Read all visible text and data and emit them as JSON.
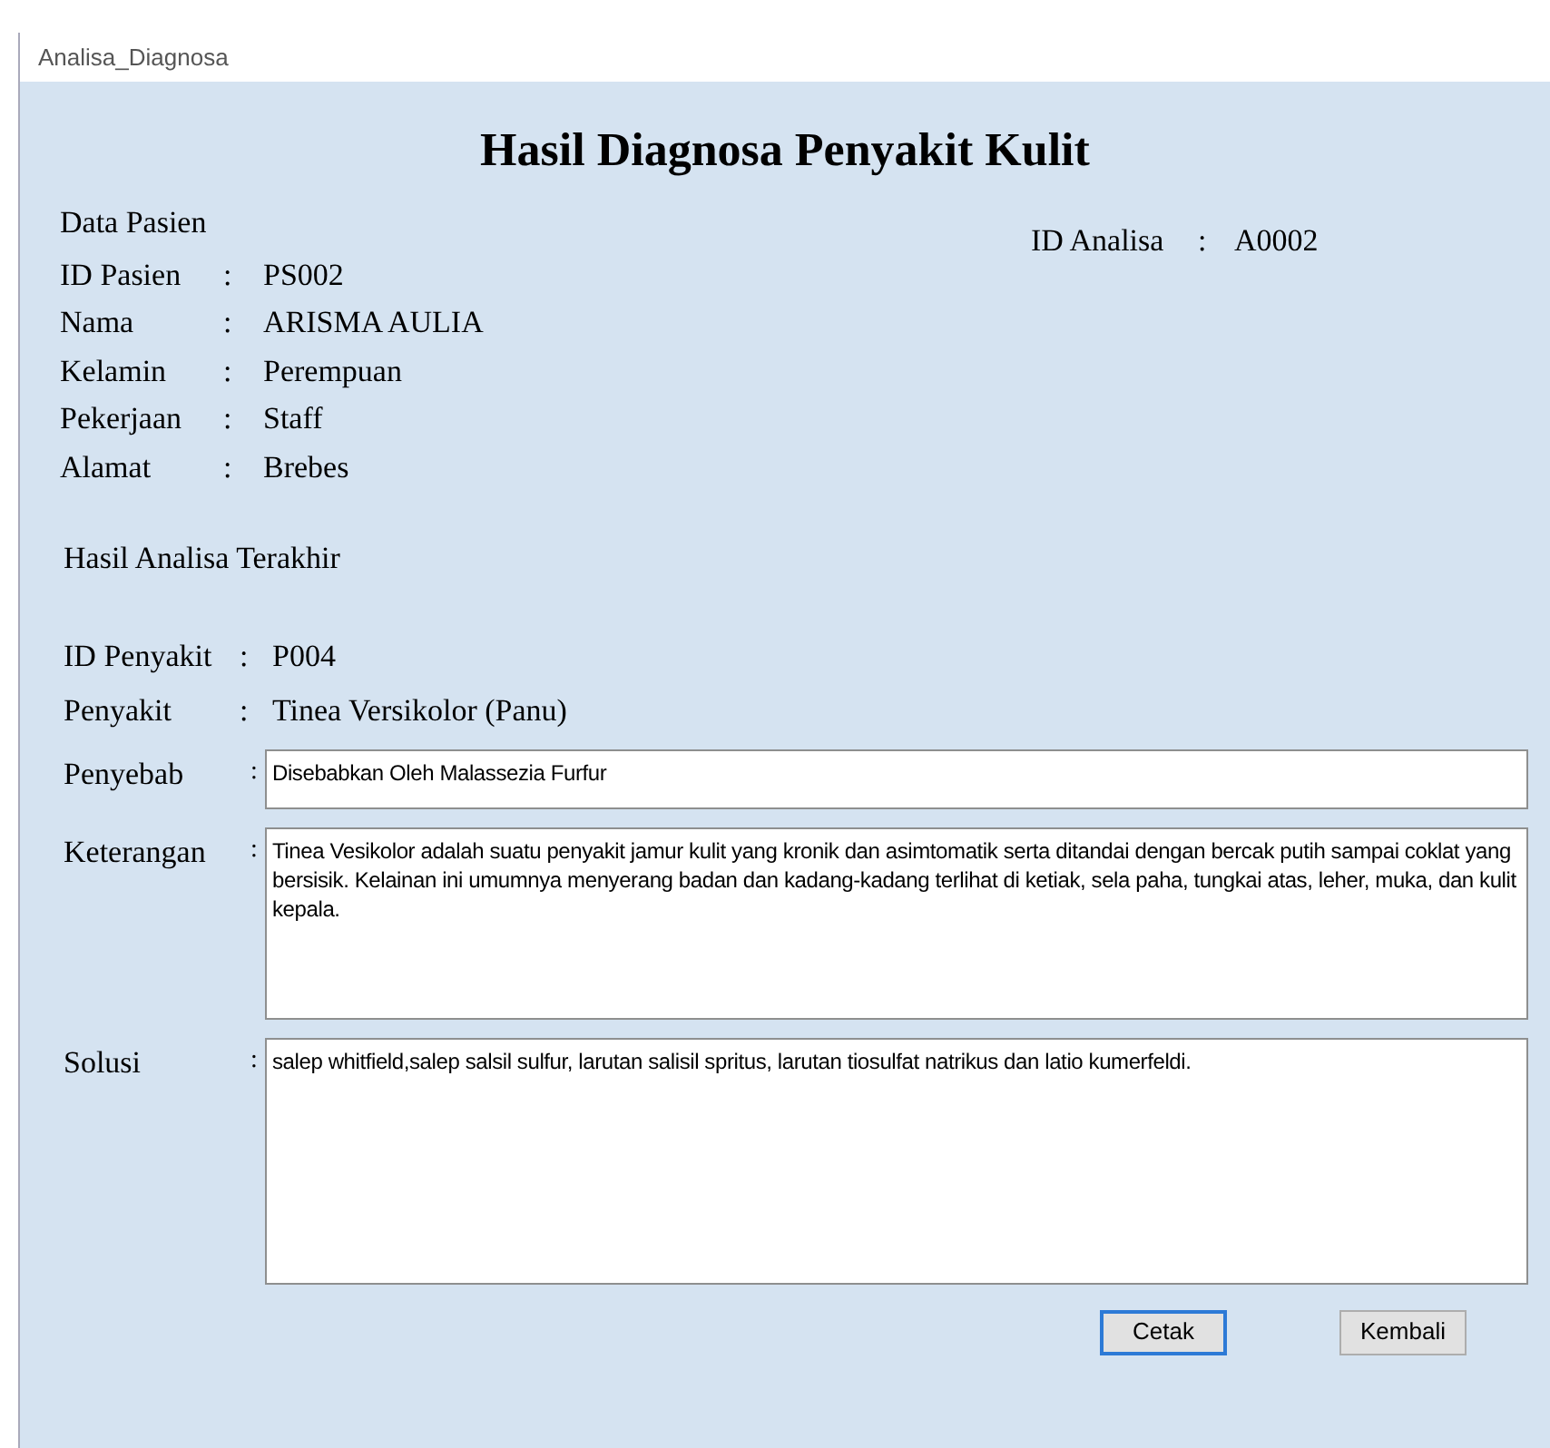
{
  "window": {
    "title": "Analisa_Diagnosa"
  },
  "heading": "Hasil Diagnosa Penyakit Kulit",
  "patient": {
    "title": "Data Pasien",
    "fields": [
      {
        "label": "ID Pasien",
        "separator": ":",
        "value": "PS002"
      },
      {
        "label": "Nama",
        "separator": ":",
        "value": "ARISMA AULIA"
      },
      {
        "label": "Kelamin",
        "separator": ":",
        "value": "Perempuan"
      },
      {
        "label": "Pekerjaan",
        "separator": ":",
        "value": "Staff"
      },
      {
        "label": "Alamat",
        "separator": ":",
        "value": "Brebes"
      }
    ]
  },
  "analysis_id": {
    "label": "ID Analisa",
    "separator": ":",
    "value": "A0002"
  },
  "result": {
    "title": "Hasil Analisa Terakhir",
    "fields": [
      {
        "label": "ID Penyakit",
        "separator": ":",
        "value": "P004"
      },
      {
        "label": "Penyakit",
        "separator": ":",
        "value": "Tinea Versikolor (Panu)"
      }
    ],
    "text_fields": [
      {
        "label": "Penyebab",
        "separator": ":",
        "value": "Disebabkan Oleh Malassezia Furfur",
        "kind": "single"
      },
      {
        "label": "Keterangan",
        "separator": ":",
        "value": "Tinea Vesikolor adalah suatu penyakit jamur kulit yang kronik dan asimtomatik serta ditandai dengan bercak putih sampai coklat yang bersisik. Kelainan ini umumnya menyerang badan dan kadang-kadang terlihat di ketiak, sela paha, tungkai atas, leher, muka, dan kulit kepala.",
        "kind": "medium"
      },
      {
        "label": "Solusi",
        "separator": ":",
        "value": "salep whitfield,salep salsil sulfur, larutan salisil spritus, larutan tiosulfat natrikus dan latio kumerfeldi.",
        "kind": "large"
      }
    ]
  },
  "buttons": [
    {
      "label": "Cetak",
      "focused": true
    },
    {
      "label": "Kembali",
      "focused": false
    }
  ]
}
